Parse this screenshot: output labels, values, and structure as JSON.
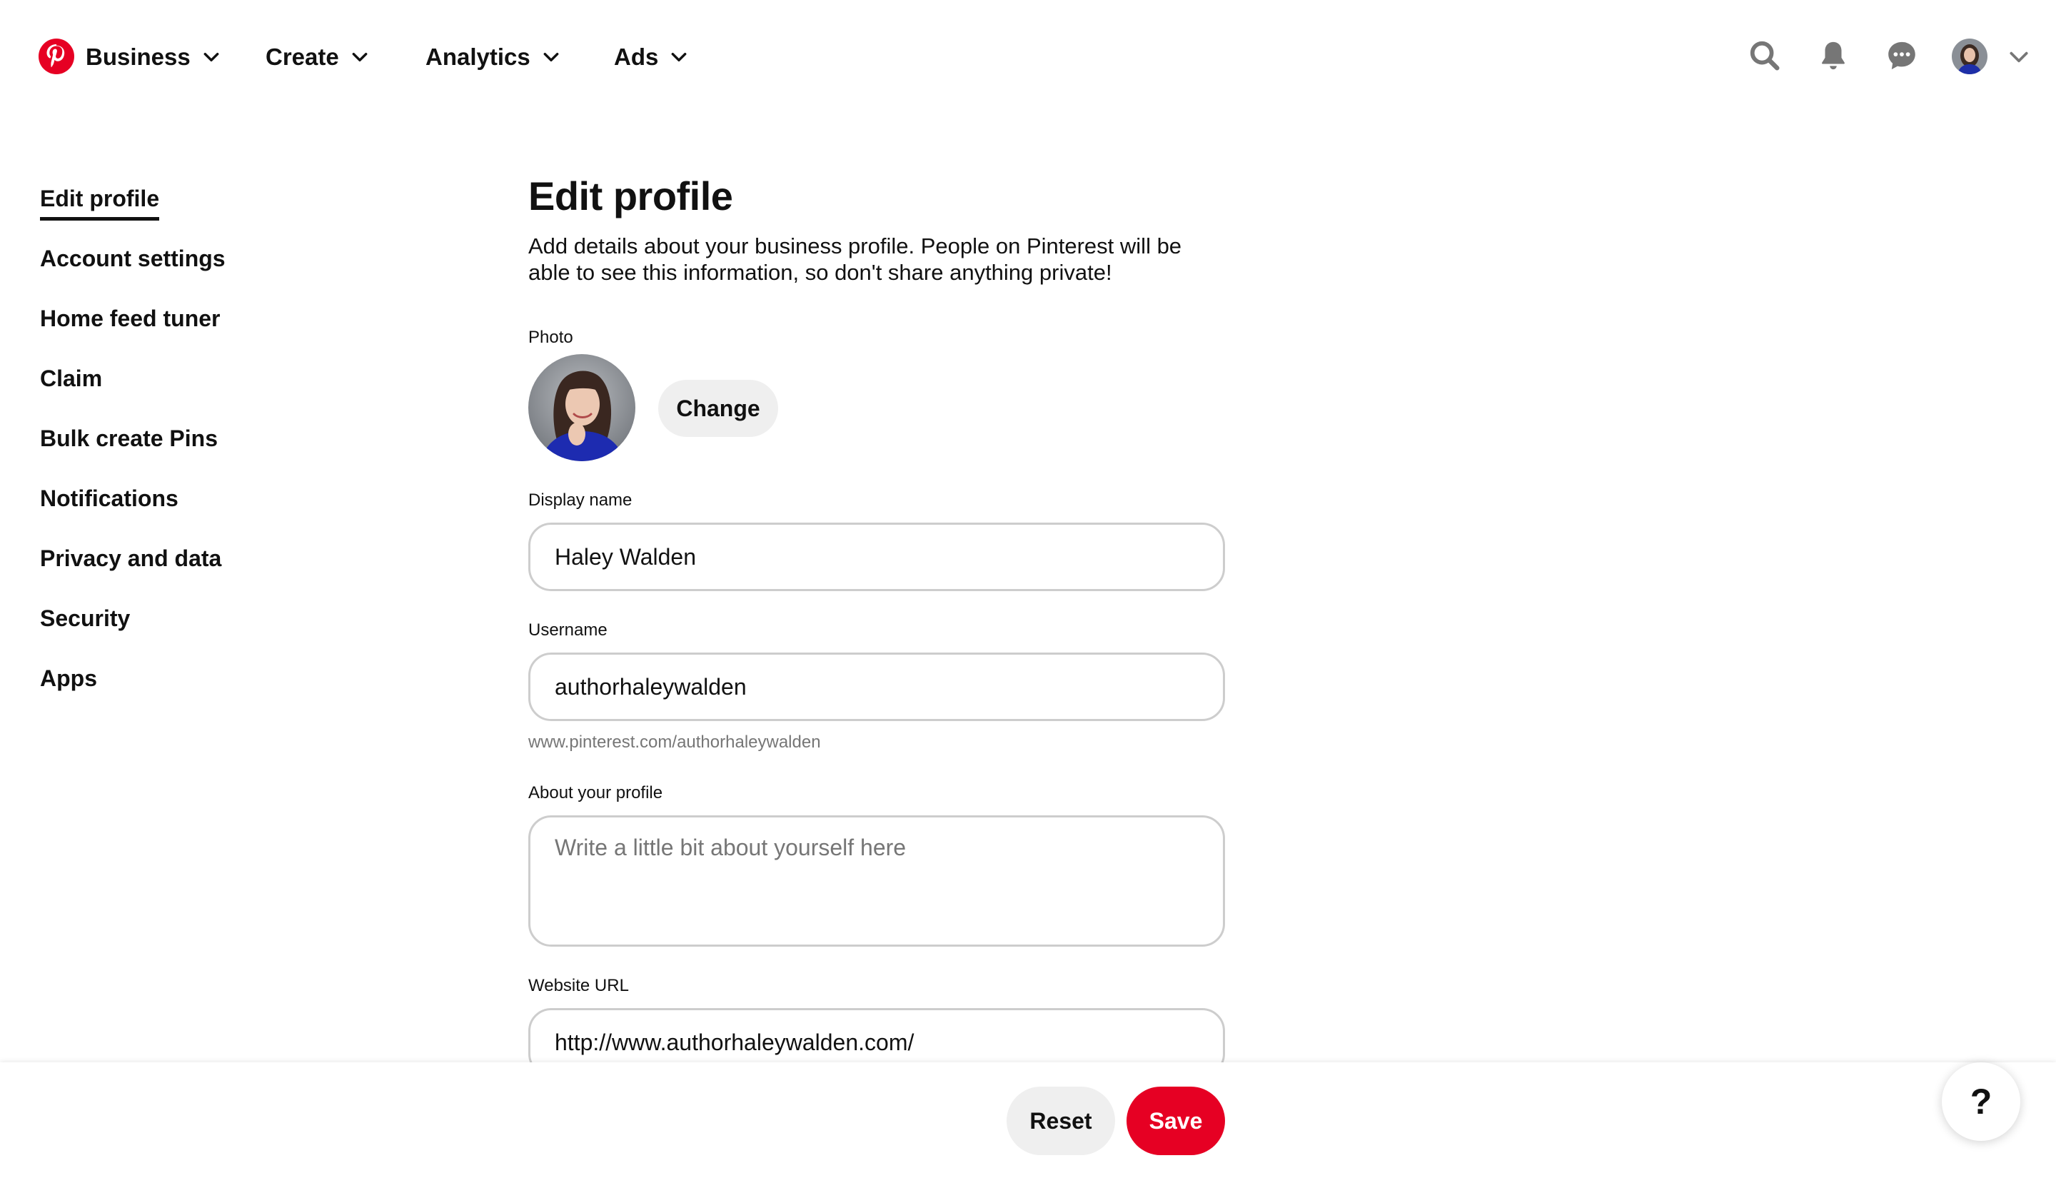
{
  "brand": {
    "accent": "#e60023",
    "icon": "pinterest-logo"
  },
  "nav": {
    "items": [
      {
        "label": "Business",
        "icon": "chevron-down"
      },
      {
        "label": "Create",
        "icon": "chevron-down"
      },
      {
        "label": "Analytics",
        "icon": "chevron-down"
      },
      {
        "label": "Ads",
        "icon": "chevron-down"
      }
    ],
    "right_icons": [
      "search-icon",
      "bell-icon",
      "messages-icon",
      "avatar",
      "chevron-down-icon"
    ]
  },
  "sidebar": {
    "items": [
      {
        "label": "Edit profile",
        "active": true
      },
      {
        "label": "Account settings"
      },
      {
        "label": "Home feed tuner"
      },
      {
        "label": "Claim"
      },
      {
        "label": "Bulk create Pins"
      },
      {
        "label": "Notifications"
      },
      {
        "label": "Privacy and data"
      },
      {
        "label": "Security"
      },
      {
        "label": "Apps"
      }
    ]
  },
  "main": {
    "title": "Edit profile",
    "subtitle": "Add details about your business profile. People on Pinterest will be able to see this information, so don't share anything private!",
    "photo": {
      "label": "Photo",
      "change_label": "Change"
    },
    "display_name": {
      "label": "Display name",
      "value": "Haley Walden"
    },
    "username": {
      "label": "Username",
      "value": "authorhaleywalden",
      "hint": "www.pinterest.com/authorhaleywalden"
    },
    "about": {
      "label": "About your profile",
      "placeholder": "Write a little bit about yourself here",
      "value": ""
    },
    "website": {
      "label": "Website URL",
      "value": "http://www.authorhaleywalden.com/"
    }
  },
  "footer": {
    "reset_label": "Reset",
    "save_label": "Save",
    "help_label": "?"
  }
}
